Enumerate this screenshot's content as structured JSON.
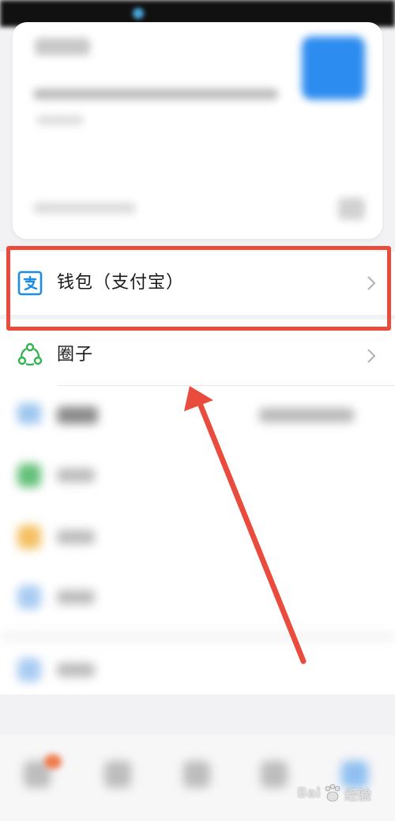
{
  "menu": {
    "wallet_label": "钱包（支付宝）",
    "circle_label": "圈子"
  },
  "icons": {
    "wallet": "alipay-wallet-icon",
    "circle": "circle-group-icon",
    "chevron": "chevron-right-icon"
  },
  "watermark": {
    "brand": "Bai",
    "suffix": "经验"
  },
  "colors": {
    "highlight": "#e94b3c",
    "arrow": "#e94b3c",
    "wallet_icon": "#1f8ce3",
    "circle_icon": "#2fb34f"
  }
}
